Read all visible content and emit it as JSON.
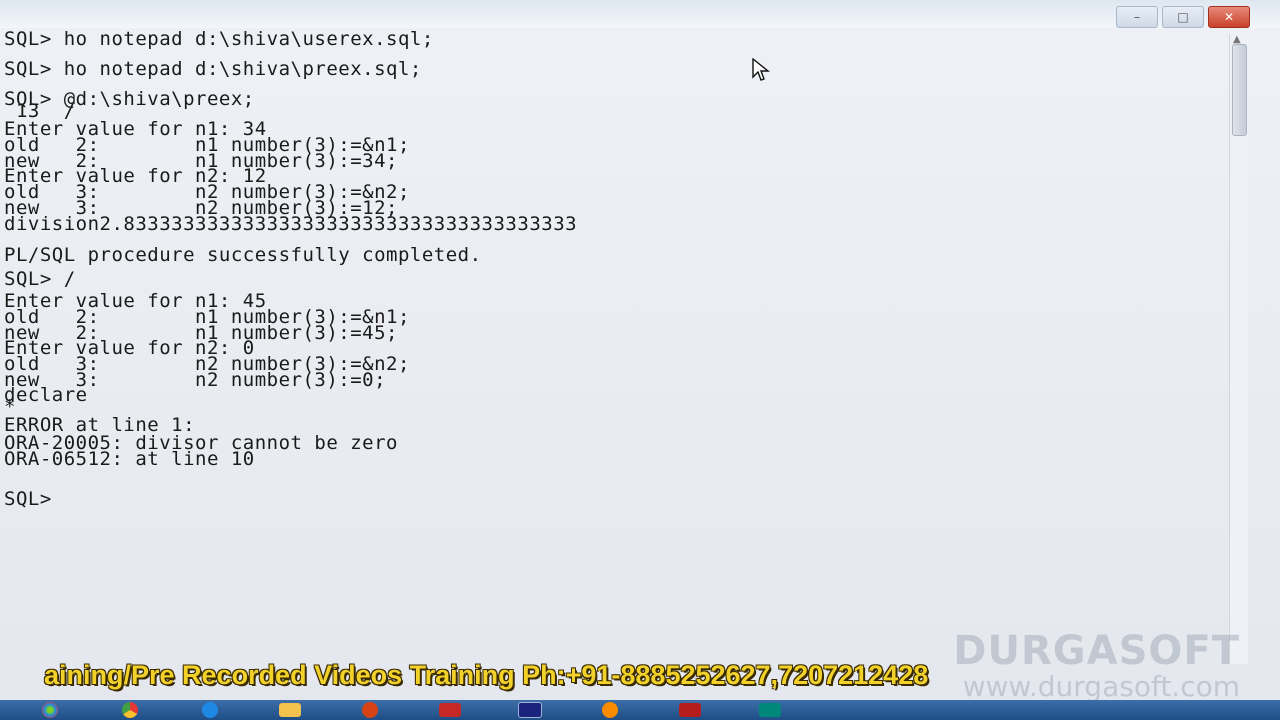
{
  "window": {
    "minimize": "–",
    "maximize": "□",
    "close": "✕"
  },
  "console": {
    "lines": [
      "SQL> ho notepad d:\\shiva\\userex.sql;",
      "SQL> ho notepad d:\\shiva\\preex.sql;",
      "SQL> @d:\\shiva\\preex;",
      " 13  /",
      "Enter value for n1: 34",
      "old   2:        n1 number(3):=&n1;",
      "new   2:        n1 number(3):=34;",
      "Enter value for n2: 12",
      "old   3:        n2 number(3):=&n2;",
      "new   3:        n2 number(3):=12;",
      "division2.83333333333333333333333333333333333333",
      "",
      "PL/SQL procedure successfully completed.",
      "",
      "SQL> /",
      "Enter value for n1: 45",
      "old   2:        n1 number(3):=&n1;",
      "new   2:        n1 number(3):=45;",
      "Enter value for n2: 0",
      "old   3:        n2 number(3):=&n2;",
      "new   3:        n2 number(3):=0;",
      "declare",
      "*",
      "ERROR at line 1:",
      "ORA-20005: divisor cannot be zero",
      "ORA-06512: at line 10",
      "",
      "SQL>"
    ]
  },
  "watermark": {
    "title": "DURGASOFT",
    "url": "www.durgasoft.com"
  },
  "ticker": {
    "text": "aining/Pre Recorded Videos Training Ph:+91-8885252627,7207212428"
  },
  "taskbar": {
    "items": [
      "start-icon",
      "chrome-icon",
      "ie-icon",
      "folder-icon",
      "media-icon",
      "app-icon",
      "sqlplus-icon",
      "paint-icon",
      "app2-icon",
      "app3-icon"
    ]
  },
  "colors": {
    "ticker": "#f2d22a",
    "close": "#c9412b",
    "taskbar": "#1f4e86"
  }
}
